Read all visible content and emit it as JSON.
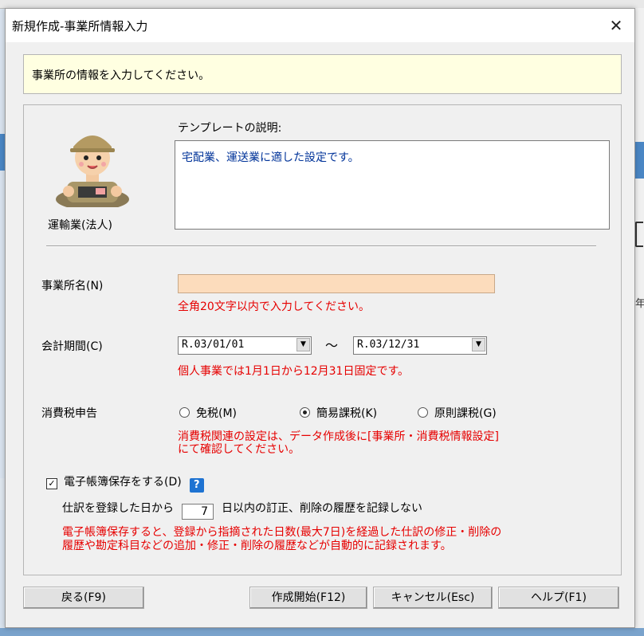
{
  "dialog": {
    "title": "新規作成-事業所情報入力",
    "close_glyph": "✕",
    "banner": "事業所の情報を入力してください。"
  },
  "template": {
    "name": "運輸業(法人)",
    "description_label": "テンプレートの説明:",
    "description": "宅配業、運送業に適した設定です。",
    "avatar_icon": "worker-avatar-icon"
  },
  "office_name": {
    "label": "事業所名(N)",
    "value": "",
    "hint": "全角20文字以内で入力してください。",
    "input_color": "#fcdcbc"
  },
  "fiscal_period": {
    "label": "会計期間(C)",
    "start": "R.03/01/01",
    "separator": "〜",
    "end": "R.03/12/31",
    "hint": "個人事業では1月1日から12月31日固定です。"
  },
  "consumption_tax": {
    "label": "消費税申告",
    "options": [
      {
        "label": "免税(M)",
        "selected": false
      },
      {
        "label": "簡易課税(K)",
        "selected": true
      },
      {
        "label": "原則課税(G)",
        "selected": false
      }
    ],
    "hint_line1": "消費税関連の設定は、データ作成後に[事業所・消費税情報設定]",
    "hint_line2": "にて確認してください。"
  },
  "e_book": {
    "checkbox_label": "電子帳簿保存をする(D)",
    "checked": true,
    "help_glyph": "?",
    "days_prefix": "仕訳を登録した日から",
    "days_value": "7",
    "days_suffix": "日以内の訂正、削除の履歴を記録しない",
    "hint_line1": "電子帳簿保存すると、登録から指摘された日数(最大7日)を経過した仕訳の修正・削除の",
    "hint_line2": "履歴や勘定科目などの追加・修正・削除の履歴などが自動的に記録されます。"
  },
  "buttons": {
    "back": "戻る(F9)",
    "start": "作成開始(F12)",
    "cancel": "キャンセル(Esc)",
    "help": "ヘルプ(F1)"
  },
  "background": {
    "right_glyph": "年"
  },
  "colors": {
    "hint_red": "#e60000",
    "description_blue": "#003399",
    "help_blue": "#1e73d2",
    "banner_bg": "#ffffe1"
  }
}
